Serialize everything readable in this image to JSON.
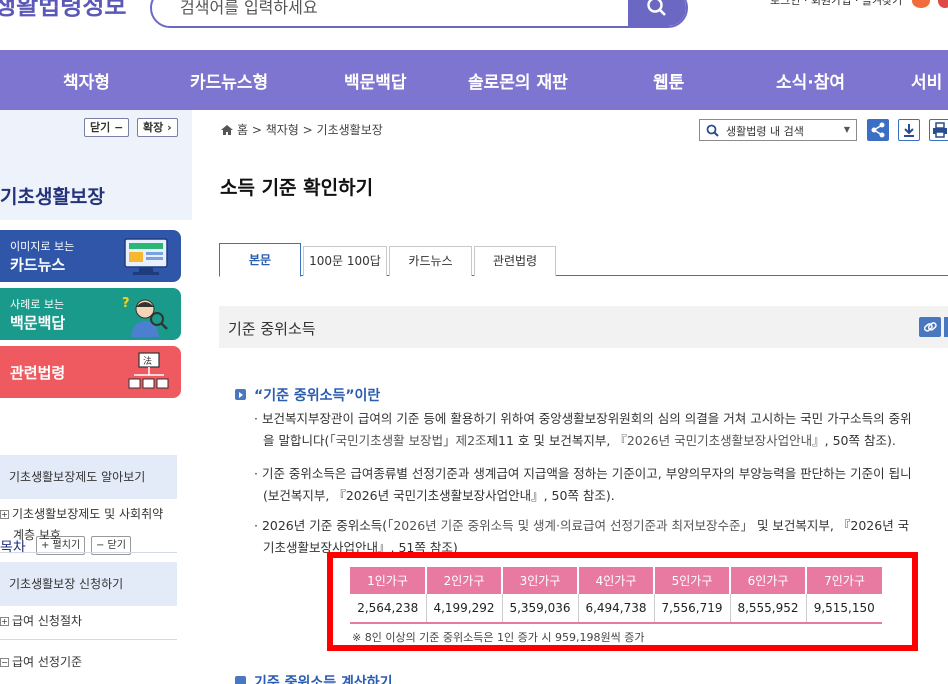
{
  "header": {
    "logo": "생활법령정보",
    "search_placeholder": "검색어를 입력하세요",
    "utility_text": "로그인 · 회원가입 · 즐겨찾기"
  },
  "nav": {
    "items": [
      "책자형",
      "카드뉴스형",
      "백문백답",
      "솔로몬의 재판",
      "웹툰",
      "소식·참여",
      "서비"
    ]
  },
  "sidebar": {
    "collapse_label": "닫기 −",
    "expand_label": "확장 ›",
    "title": "기초생활보장",
    "banners": [
      {
        "small": "이미지로 보는",
        "big": "카드뉴스",
        "color": "#2f56a8",
        "icon": "monitor-news-icon"
      },
      {
        "small": "사례로 보는",
        "big": "백문백답",
        "color": "#1a9a8a",
        "icon": "question-person-icon"
      },
      {
        "small": "",
        "big": "관련법령",
        "color": "#ee5a5f",
        "icon": "law-document-icon"
      }
    ],
    "toc": {
      "title": "목차",
      "expand_all": "+ 펼치기",
      "collapse_all": "− 닫기",
      "items": [
        {
          "type": "category",
          "label": "기초생활보장제도 알아보기"
        },
        {
          "type": "sub",
          "line1": "기초생활보장제도 및 사회취약",
          "line2": "계층 보호"
        },
        {
          "type": "category",
          "label": "기초생활보장 신청하기"
        },
        {
          "type": "sub",
          "line1": "급여 신청절차",
          "line2": ""
        },
        {
          "type": "sub",
          "line1": "급여 선정기준",
          "line2": ""
        }
      ]
    }
  },
  "content": {
    "breadcrumb": "홈 > 책자형 > 기초생활보장",
    "law_search_label": "생활법령 내 검색",
    "page_title": "소득 기준 확인하기",
    "tabs": [
      "본문",
      "100문 100답",
      "카드뉴스",
      "관련법령"
    ],
    "active_tab": "본문",
    "section_title": "기준 중위소득",
    "subheading": "“기준 중위소득”이란",
    "paragraphs": [
      {
        "l1": "보건복지부장관이 급여의 기준 등에 활용하기 위하여 중앙생활보장위원회의 심의 의결을 거쳐 고시하는 국민 가구소득의 중위",
        "l2a": "을 말합니다(",
        "l2b": "「국민기초생활 보장법」제2조",
        "l2c": "제11 호 및 보건복지부, ",
        "l2d": "『2026년 국민기초생활보장사업안내』",
        "l2e": ", 50쪽 참조)."
      },
      {
        "l1": "기준 중위소득은 급여종류별 선정기준과 생계급여 지급액을 정하는 기준이고, 부양의무자의 부양능력을 판단하는 기준이 됩니",
        "l2a": "(보건복지부, 『2026년 국민기초생활보장사업안내』, 50쪽 참조)."
      },
      {
        "l1a": "2026년 기준 중위소득(",
        "l1b": "「2026년 기준 중위소득 및 생계·의료급여 선정기준과 최저보장수준」",
        "l1c": " 및 보건복지부, 『2026년 국",
        "l2a": "기초생활보장사업안내』, 51쪽 참조)"
      }
    ],
    "table": {
      "headers": [
        "1인가구",
        "2인가구",
        "3인가구",
        "4인가구",
        "5인가구",
        "6인가구",
        "7인가구"
      ],
      "values": [
        "2,564,238",
        "4,199,292",
        "5,359,036",
        "6,494,738",
        "7,556,719",
        "8,555,952",
        "9,515,150"
      ],
      "note": "※ 8인 이상의 기준 중위소득은 1인 증가 시 959,198원씩 증가"
    },
    "next_heading": "기준 중위소득 계산하기"
  },
  "colors": {
    "nav_bg": "#7d75d0",
    "table_header": "#e87aa2",
    "highlight_box": "#ff0000",
    "accent_blue": "#2a5db0"
  }
}
